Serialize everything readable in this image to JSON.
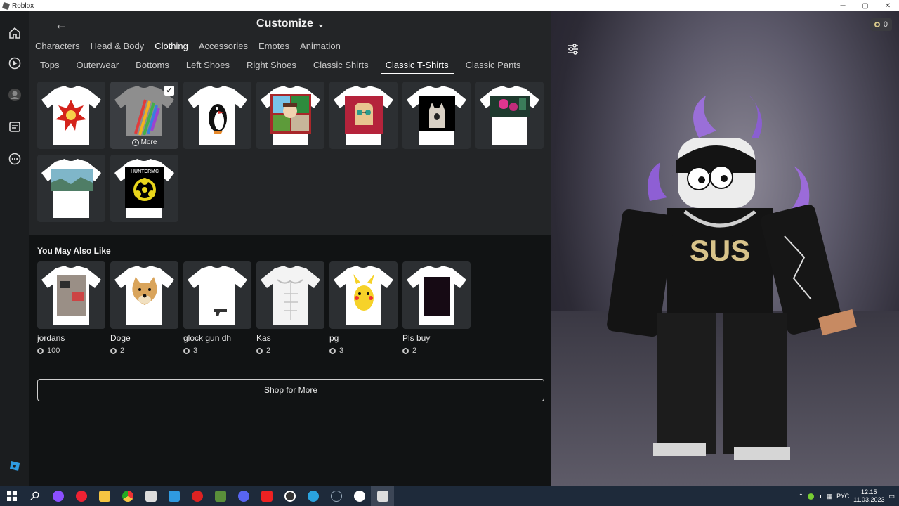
{
  "window": {
    "title": "Roblox"
  },
  "header": {
    "title": "Customize"
  },
  "tabs_primary": [
    {
      "label": "Characters"
    },
    {
      "label": "Head & Body"
    },
    {
      "label": "Clothing",
      "active": true
    },
    {
      "label": "Accessories"
    },
    {
      "label": "Emotes"
    },
    {
      "label": "Animation"
    }
  ],
  "tabs_secondary": [
    {
      "label": "Tops"
    },
    {
      "label": "Outerwear"
    },
    {
      "label": "Bottoms"
    },
    {
      "label": "Left Shoes"
    },
    {
      "label": "Right Shoes"
    },
    {
      "label": "Classic Shirts"
    },
    {
      "label": "Classic T-Shirts",
      "active": true
    },
    {
      "label": "Classic Pants"
    }
  ],
  "owned_items": [
    {
      "icon": "explosion-shirt"
    },
    {
      "icon": "rainbow-claw-shirt",
      "equipped": true,
      "more_label": "More"
    },
    {
      "icon": "penguin-shirt"
    },
    {
      "icon": "meme-collage-shirt"
    },
    {
      "icon": "toast-glasses-shirt"
    },
    {
      "icon": "cat-shirt"
    },
    {
      "icon": "pink-scene-shirt"
    },
    {
      "icon": "landscape-shirt"
    },
    {
      "icon": "biohazard-shirt",
      "print_text": "HUNTERMC"
    }
  ],
  "recommendations": {
    "title": "You May Also Like",
    "items": [
      {
        "name": "jordans",
        "price": "100",
        "icon": "shoes-photo-shirt"
      },
      {
        "name": "Doge",
        "price": "2",
        "icon": "doge-shirt"
      },
      {
        "name": "glock gun dh",
        "price": "3",
        "icon": "gun-shirt"
      },
      {
        "name": "Kas",
        "price": "2",
        "icon": "abs-shirt"
      },
      {
        "name": "pg",
        "price": "3",
        "icon": "pikachu-shirt"
      },
      {
        "name": "Pls buy",
        "price": "2",
        "icon": "dark-square-shirt"
      }
    ]
  },
  "shop_button": {
    "label": "Shop for More"
  },
  "robux_balance": "0",
  "avatar": {
    "shirt_text": "SUS"
  },
  "taskbar": {
    "time": "12:15",
    "date": "11.03.2023",
    "lang": "РУС"
  },
  "colors": {
    "accent_white": "#ffffff",
    "panel_bg": "#232527",
    "recs_bg": "#111314"
  }
}
